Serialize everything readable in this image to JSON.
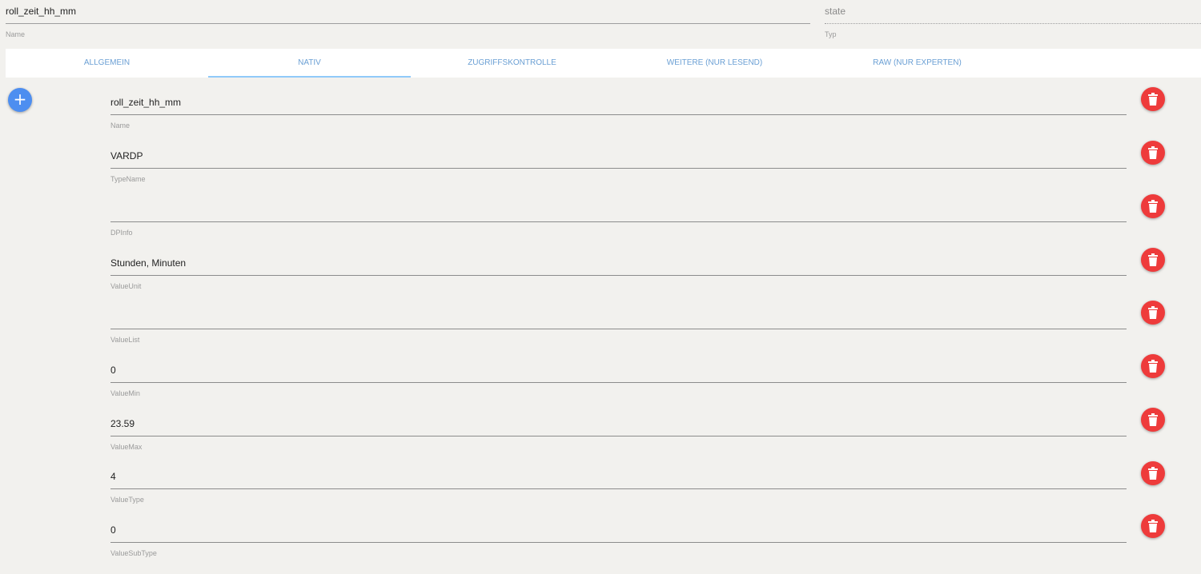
{
  "header": {
    "name": {
      "value": "roll_zeit_hh_mm",
      "label": "Name"
    },
    "type": {
      "value": "state",
      "label": "Typ"
    }
  },
  "tabs": [
    {
      "label": "ALLGEMEIN",
      "active": false
    },
    {
      "label": "NATIV",
      "active": true
    },
    {
      "label": "ZUGRIFFSKONTROLLE",
      "active": false
    },
    {
      "label": "WEITERE (NUR LESEND)",
      "active": false
    },
    {
      "label": "RAW (NUR EXPERTEN)",
      "active": false
    }
  ],
  "add_button": {
    "icon": "plus-icon",
    "symbol": "+"
  },
  "fields": [
    {
      "label": "Name",
      "value": "roll_zeit_hh_mm"
    },
    {
      "label": "TypeName",
      "value": "VARDP"
    },
    {
      "label": "DPInfo",
      "value": ""
    },
    {
      "label": "ValueUnit",
      "value": "Stunden, Minuten"
    },
    {
      "label": "ValueList",
      "value": ""
    },
    {
      "label": "ValueMin",
      "value": "0"
    },
    {
      "label": "ValueMax",
      "value": "23.59"
    },
    {
      "label": "ValueType",
      "value": "4"
    },
    {
      "label": "ValueSubType",
      "value": "0"
    }
  ],
  "colors": {
    "accent": "#6a9fd4",
    "add_button": "#4d8ef0",
    "delete_button": "#ee3b3b",
    "background": "#f2f1ee"
  }
}
